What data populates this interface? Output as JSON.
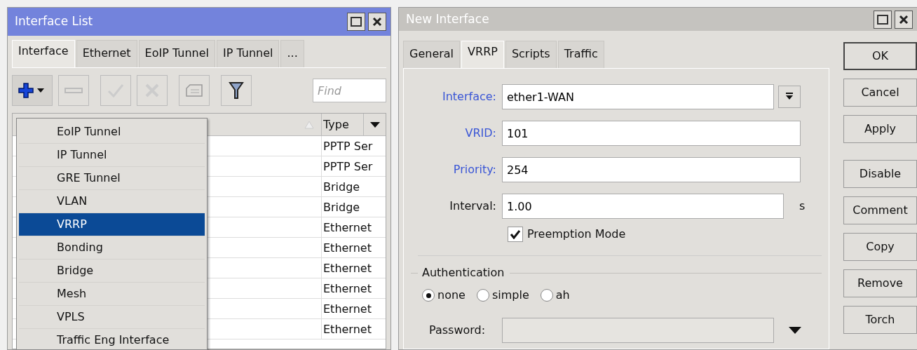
{
  "interface_list": {
    "title": "Interface List",
    "tabs": [
      {
        "label": "Interface",
        "selected": true
      },
      {
        "label": "Ethernet",
        "selected": false
      },
      {
        "label": "EoIP Tunnel",
        "selected": false
      },
      {
        "label": "IP Tunnel",
        "selected": false
      },
      {
        "label": "...",
        "selected": false
      }
    ],
    "find": {
      "placeholder": "Find"
    },
    "table": {
      "columns": [
        "Type"
      ],
      "rows": [
        {
          "type": "PPTP Ser"
        },
        {
          "type": "PPTP Ser"
        },
        {
          "type": "Bridge"
        },
        {
          "type": "Bridge"
        },
        {
          "type": "Ethernet"
        },
        {
          "type": "Ethernet"
        },
        {
          "type": "Ethernet"
        },
        {
          "type": "Ethernet"
        },
        {
          "type": "Ethernet"
        },
        {
          "type": "Ethernet"
        }
      ]
    },
    "add_menu": [
      {
        "label": "EoIP Tunnel",
        "selected": false
      },
      {
        "label": "IP Tunnel",
        "selected": false
      },
      {
        "label": "GRE Tunnel",
        "selected": false
      },
      {
        "label": "VLAN",
        "selected": false
      },
      {
        "label": "VRRP",
        "selected": true
      },
      {
        "label": "Bonding",
        "selected": false
      },
      {
        "label": "Bridge",
        "selected": false
      },
      {
        "label": "Mesh",
        "selected": false
      },
      {
        "label": "VPLS",
        "selected": false
      },
      {
        "label": "Traffic Eng Interface",
        "selected": false
      }
    ]
  },
  "new_interface": {
    "title": "New Interface",
    "tabs": [
      {
        "label": "General",
        "selected": false
      },
      {
        "label": "VRRP",
        "selected": true
      },
      {
        "label": "Scripts",
        "selected": false
      },
      {
        "label": "Traffic",
        "selected": false
      }
    ],
    "fields": [
      {
        "kind": "dropdown",
        "label": "Interface:",
        "value": "ether1-WAN",
        "changed": true
      },
      {
        "kind": "text",
        "label": "VRID:",
        "value": "101",
        "changed": true
      },
      {
        "kind": "text",
        "label": "Priority:",
        "value": "254",
        "changed": true
      },
      {
        "kind": "unit",
        "label": "Interval:",
        "value": "1.00",
        "unit": "s",
        "changed": false
      }
    ],
    "preemption_mode": {
      "label": "Preemption Mode",
      "checked": true
    },
    "authentication": {
      "title": "Authentication",
      "options": [
        {
          "label": "none",
          "selected": true
        },
        {
          "label": "simple",
          "selected": false
        },
        {
          "label": "ah",
          "selected": false
        }
      ]
    },
    "password": {
      "label": "Password:"
    },
    "buttons": [
      "OK",
      "Cancel",
      "Apply",
      "Disable",
      "Comment",
      "Copy",
      "Remove",
      "Torch"
    ]
  }
}
